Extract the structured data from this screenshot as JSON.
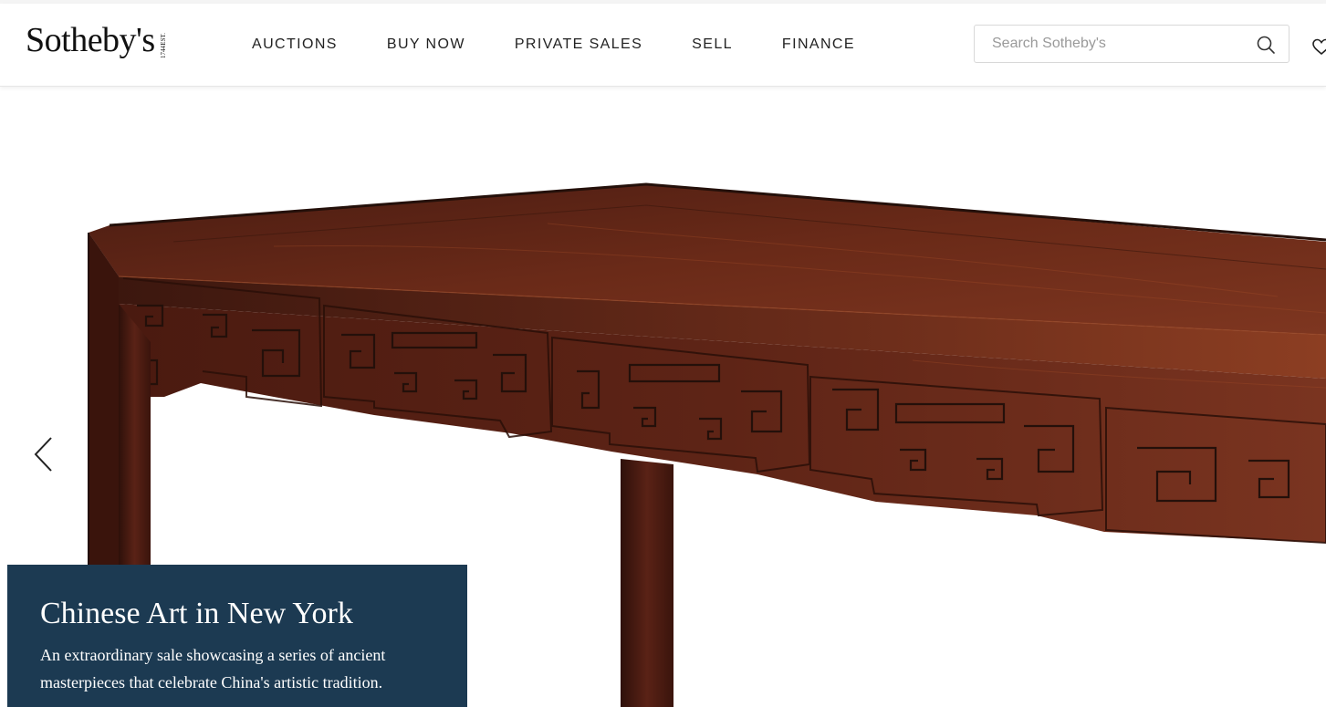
{
  "brand": {
    "name": "Sotheby's",
    "est_label": "EST.",
    "est_year": "1744"
  },
  "nav": {
    "items": [
      {
        "label": "AUCTIONS"
      },
      {
        "label": "BUY NOW"
      },
      {
        "label": "PRIVATE SALES"
      },
      {
        "label": "SELL"
      },
      {
        "label": "FINANCE"
      }
    ]
  },
  "search": {
    "placeholder": "Search Sotheby's",
    "value": "",
    "icon": "search-icon"
  },
  "header_actions": {
    "favorites_icon": "heart-icon"
  },
  "hero": {
    "image": "carved hardwood table with key-fret apron",
    "prev_icon": "chevron-left-icon",
    "title": "Chinese Art in New York",
    "description": "An extraordinary sale showcasing a series of ancient masterpieces that celebrate China's artistic tradition."
  },
  "colors": {
    "caption_bg": "#1c3a52",
    "wood_dark": "#3a1810",
    "wood_mid": "#6e2c1a",
    "wood_light": "#8a3a20"
  }
}
